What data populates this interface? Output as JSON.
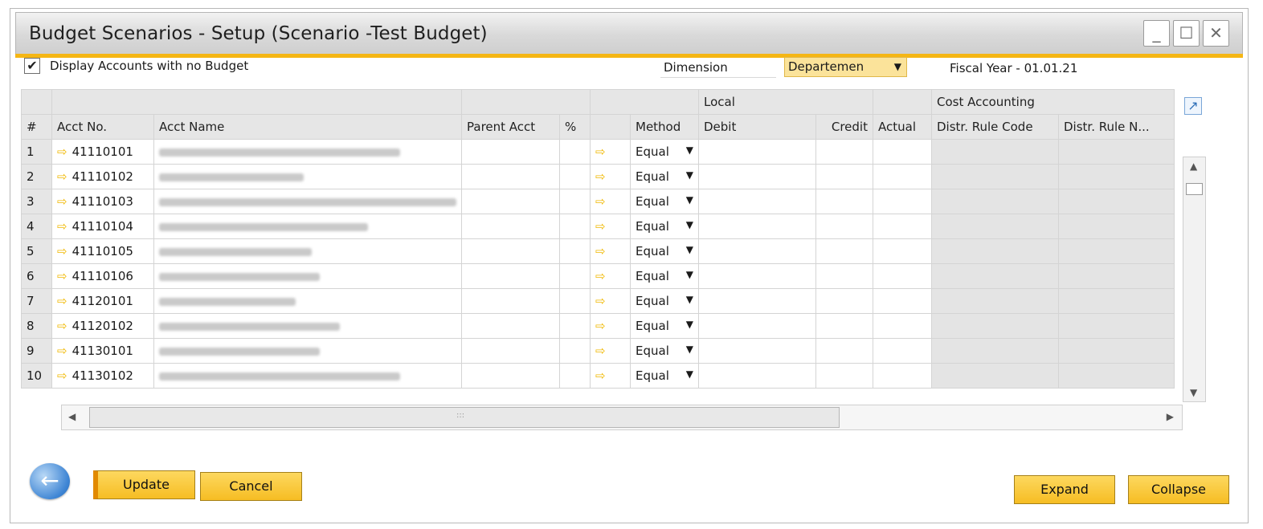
{
  "window": {
    "title": "Budget Scenarios - Setup (Scenario -Test Budget)",
    "controls": {
      "minimize": "_",
      "maximize": "☐",
      "close": "✕"
    }
  },
  "filters": {
    "display_no_budget_checked": true,
    "display_no_budget_check_glyph": "✔",
    "display_no_budget_label": "Display Accounts with no Budget",
    "dimension_label": "Dimension",
    "dimension_value": "Departemen",
    "fiscal_year": "Fiscal Year - 01.01.21"
  },
  "grid": {
    "group_headers": {
      "local": "Local",
      "cost_accounting": "Cost Accounting"
    },
    "columns": {
      "num": "#",
      "acct_no": "Acct No.",
      "acct_name": "Acct Name",
      "parent_acct": "Parent Acct",
      "percent": "%",
      "method": "Method",
      "debit": "Debit",
      "credit": "Credit",
      "actual": "Actual",
      "distr_rule_code": "Distr. Rule Code",
      "distr_rule_name": "Distr. Rule N..."
    },
    "rows": [
      {
        "num": "1",
        "acct_no": "41110101",
        "method": "Equal"
      },
      {
        "num": "2",
        "acct_no": "41110102",
        "method": "Equal"
      },
      {
        "num": "3",
        "acct_no": "41110103",
        "method": "Equal"
      },
      {
        "num": "4",
        "acct_no": "41110104",
        "method": "Equal"
      },
      {
        "num": "5",
        "acct_no": "41110105",
        "method": "Equal"
      },
      {
        "num": "6",
        "acct_no": "41110106",
        "method": "Equal"
      },
      {
        "num": "7",
        "acct_no": "41120101",
        "method": "Equal"
      },
      {
        "num": "8",
        "acct_no": "41120102",
        "method": "Equal"
      },
      {
        "num": "9",
        "acct_no": "41130101",
        "method": "Equal"
      },
      {
        "num": "10",
        "acct_no": "41130102",
        "method": "Equal"
      }
    ]
  },
  "icons": {
    "link_arrow": "⇨",
    "caret_down": "▼",
    "scroll_up": "▲",
    "scroll_down": "▼",
    "scroll_left": "◀",
    "scroll_right": "▶",
    "grip": ":::",
    "expand_grid": "↗",
    "back": "←"
  },
  "buttons": {
    "update": "Update",
    "cancel": "Cancel",
    "expand": "Expand",
    "collapse": "Collapse"
  }
}
